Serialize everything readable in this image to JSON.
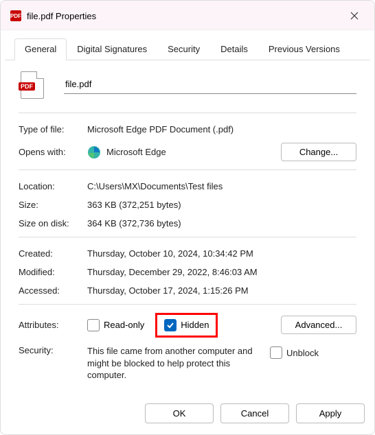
{
  "titlebar": {
    "badge": "PDF",
    "title": "file.pdf Properties"
  },
  "tabs": [
    {
      "label": "General",
      "active": true
    },
    {
      "label": "Digital Signatures",
      "active": false
    },
    {
      "label": "Security",
      "active": false
    },
    {
      "label": "Details",
      "active": false
    },
    {
      "label": "Previous Versions",
      "active": false
    }
  ],
  "file": {
    "icon_badge": "PDF",
    "name": "file.pdf"
  },
  "rows": {
    "type_of_file_label": "Type of file:",
    "type_of_file_value": "Microsoft Edge PDF Document (.pdf)",
    "opens_with_label": "Opens with:",
    "opens_with_value": "Microsoft Edge",
    "change_button": "Change...",
    "location_label": "Location:",
    "location_value": "C:\\Users\\MX\\Documents\\Test files",
    "size_label": "Size:",
    "size_value": "363 KB (372,251 bytes)",
    "size_on_disk_label": "Size on disk:",
    "size_on_disk_value": "364 KB (372,736 bytes)",
    "created_label": "Created:",
    "created_value": "Thursday, October 10, 2024, 10:34:42 PM",
    "modified_label": "Modified:",
    "modified_value": "Thursday, December 29, 2022, 8:46:03 AM",
    "accessed_label": "Accessed:",
    "accessed_value": "Thursday, October 17, 2024, 1:15:26 PM",
    "attributes_label": "Attributes:",
    "readonly_label": "Read-only",
    "readonly_checked": false,
    "hidden_label": "Hidden",
    "hidden_checked": true,
    "advanced_button": "Advanced...",
    "security_label": "Security:",
    "security_text": "This file came from another computer and might be blocked to help protect this computer.",
    "unblock_label": "Unblock",
    "unblock_checked": false
  },
  "footer": {
    "ok": "OK",
    "cancel": "Cancel",
    "apply": "Apply"
  }
}
